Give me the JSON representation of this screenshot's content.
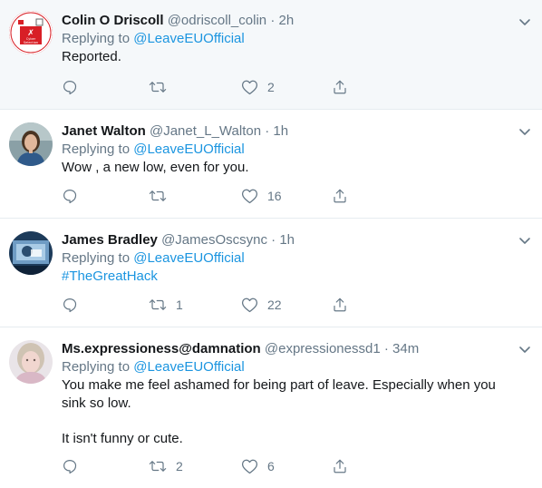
{
  "tweets": [
    {
      "name": "Colin O Driscoll",
      "handle": "@odriscoll_colin",
      "time": "2h",
      "replying_prefix": "Replying to",
      "replying_to": "@LeaveEUOfficial",
      "text_lines": [
        "Reported."
      ],
      "hashtag": "",
      "retweets": "",
      "likes": "2",
      "avatar_badge_top": "Cyber",
      "avatar_badge_bottom": "Selection"
    },
    {
      "name": "Janet Walton",
      "handle": "@Janet_L_Walton",
      "time": "1h",
      "replying_prefix": "Replying to",
      "replying_to": "@LeaveEUOfficial",
      "text_lines": [
        "Wow , a new low, even for you."
      ],
      "hashtag": "",
      "retweets": "",
      "likes": "16"
    },
    {
      "name": "James Bradley",
      "handle": "@JamesOscsync",
      "time": "1h",
      "replying_prefix": "Replying to",
      "replying_to": "@LeaveEUOfficial",
      "text_lines": [],
      "hashtag": "#TheGreatHack",
      "retweets": "1",
      "likes": "22"
    },
    {
      "name": "Ms.expressioness@damnation",
      "handle": "@expressionessd1",
      "time": "34m",
      "replying_prefix": "Replying to",
      "replying_to": "@LeaveEUOfficial",
      "text_lines": [
        "You make me feel ashamed for being part of leave. Especially when you",
        "sink so low.",
        "It isn't funny or cute."
      ],
      "hashtag": "",
      "retweets": "2",
      "likes": "6"
    }
  ],
  "separator": "·",
  "colors": {
    "link": "#1b95e0",
    "muted": "#657786",
    "text": "#14171a",
    "highlight_bg": "#f5f8fa",
    "border": "#e6ecf0"
  },
  "icons": [
    "reply-icon",
    "retweet-icon",
    "like-icon",
    "share-icon",
    "chevron-down-icon"
  ]
}
